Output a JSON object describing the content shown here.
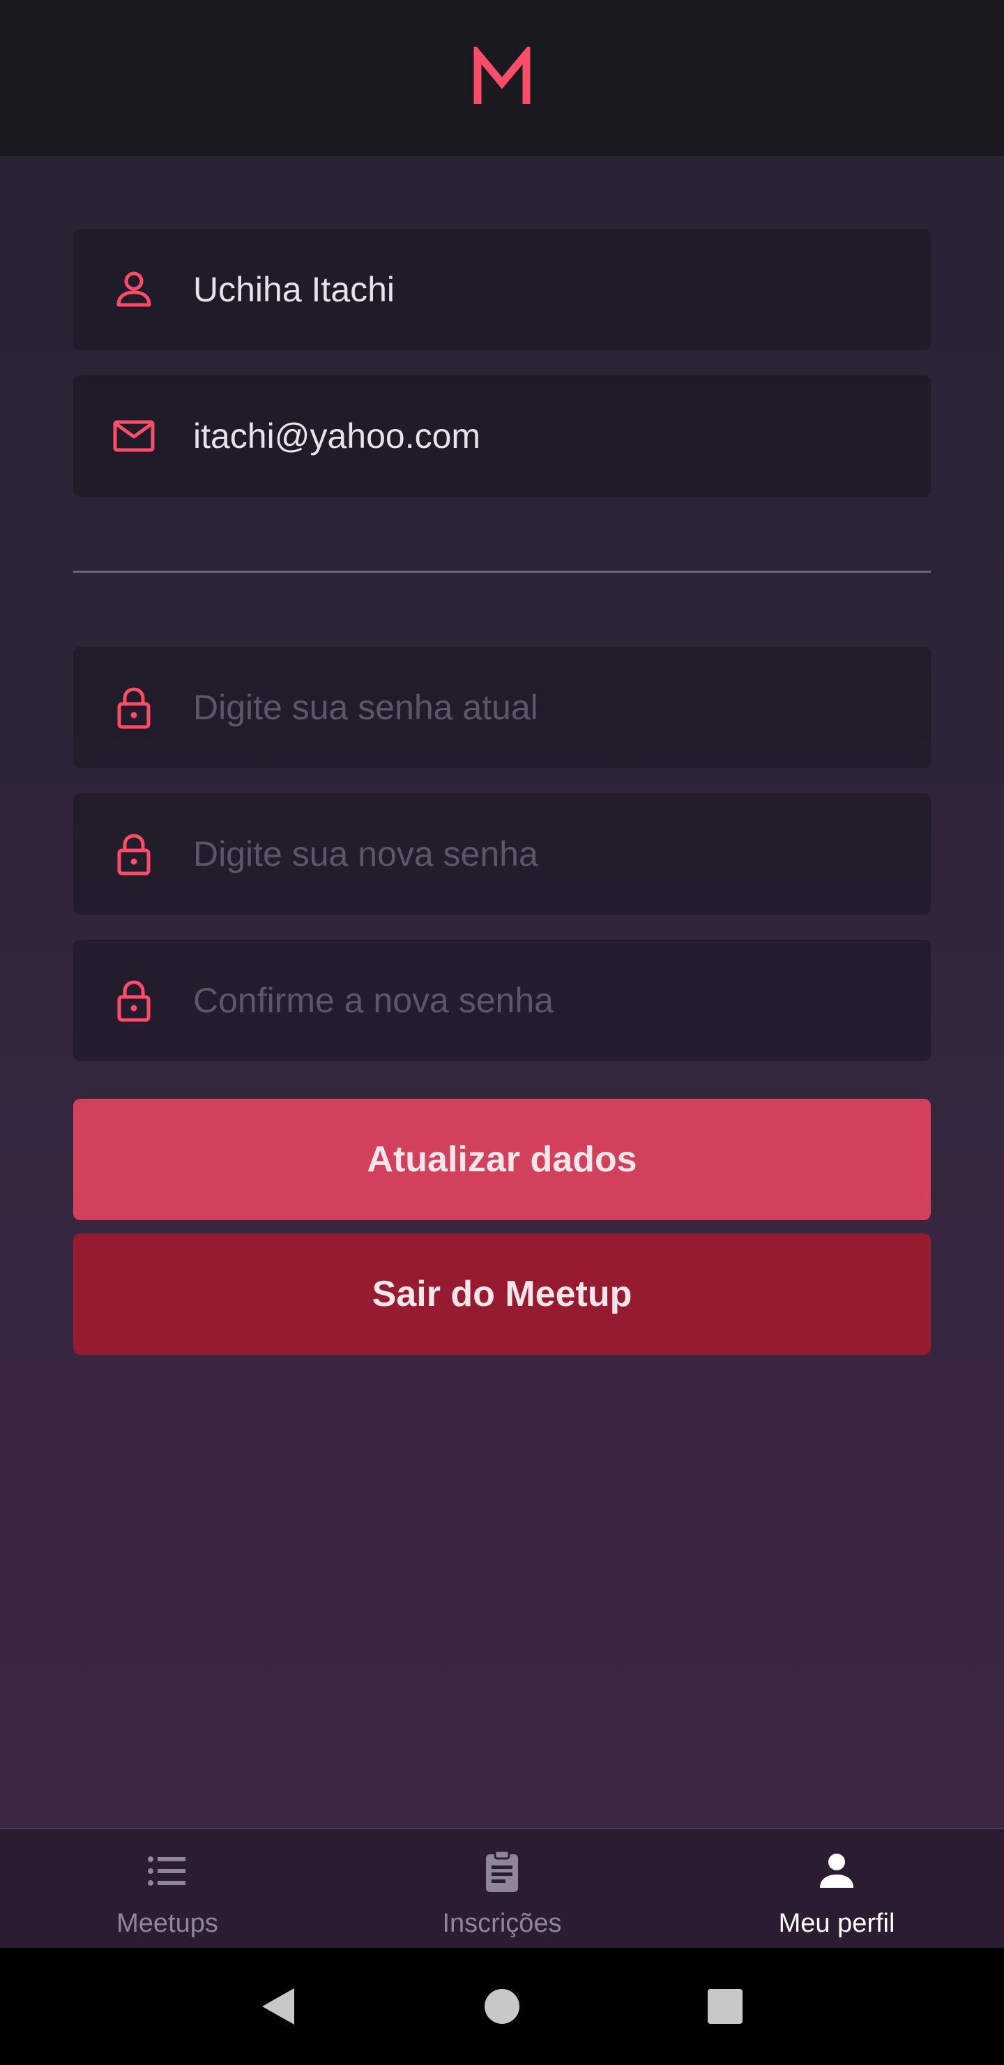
{
  "header": {
    "logo_icon": "meetup-m-logo"
  },
  "profile": {
    "name_value": "Uchiha Itachi",
    "email_value": "itachi@yahoo.com"
  },
  "password": {
    "current_placeholder": "Digite sua senha atual",
    "new_placeholder": "Digite sua nova senha",
    "confirm_placeholder": "Confirme a nova senha"
  },
  "actions": {
    "update_label": "Atualizar dados",
    "logout_label": "Sair do Meetup"
  },
  "tabbar": {
    "tabs": [
      {
        "label": "Meetups",
        "icon": "list-icon",
        "active": false
      },
      {
        "label": "Inscrições",
        "icon": "clipboard-icon",
        "active": false
      },
      {
        "label": "Meu perfil",
        "icon": "person-icon",
        "active": true
      }
    ]
  },
  "system_nav": {
    "icons": [
      "back-icon",
      "home-icon",
      "recents-icon"
    ]
  },
  "colors": {
    "accent": "#f94d6a",
    "primary_button": "#d3405c",
    "danger_button": "#961b30",
    "header_bg": "#1a191f"
  }
}
